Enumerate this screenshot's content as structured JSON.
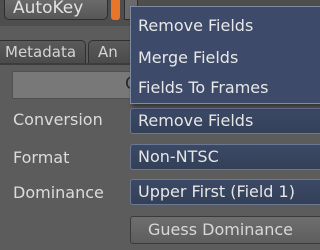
{
  "toolbar": {
    "autokey_label": "AutoKey"
  },
  "tabs": [
    {
      "label": "Metadata"
    },
    {
      "label": "An"
    }
  ],
  "panel": {
    "partial_button_text": "C"
  },
  "form": {
    "conversion": {
      "label": "Conversion",
      "value": "Remove Fields"
    },
    "format": {
      "label": "Format",
      "value": "Non-NTSC"
    },
    "dominance": {
      "label": "Dominance",
      "value": "Upper First (Field 1)"
    },
    "guess_button_label": "Guess Dominance"
  },
  "dropdown": {
    "items": [
      {
        "label": "Remove Fields"
      },
      {
        "label": "Merge Fields"
      },
      {
        "label": "Fields To Frames"
      }
    ]
  },
  "colors": {
    "autokey_indicator": "#e8762a",
    "field_background": "#3c4966",
    "panel_background": "#5c5c5c"
  }
}
